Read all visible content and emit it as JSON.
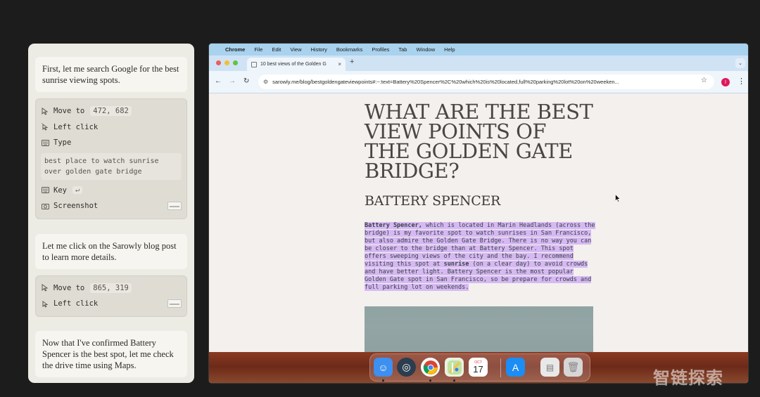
{
  "agent_panel": {
    "msg1": "First, let me search Google for the best sunrise viewing spots.",
    "actions1": [
      {
        "icon": "cursor-move-icon",
        "label": "Move to",
        "value": "472, 682"
      },
      {
        "icon": "cursor-click-icon",
        "label": "Left click",
        "value": ""
      },
      {
        "icon": "keyboard-icon",
        "label": "Type",
        "value": ""
      },
      {
        "icon": "keyboard-icon",
        "label": "Key",
        "value": "↵"
      },
      {
        "icon": "camera-icon",
        "label": "Screenshot",
        "value": ""
      }
    ],
    "typed_text": "best place to watch sunrise over golden gate bridge",
    "msg2": "Let me click on the Sarowly blog post to learn more details.",
    "actions2": [
      {
        "icon": "cursor-move-icon",
        "label": "Move to",
        "value": "865, 319"
      },
      {
        "icon": "cursor-click-icon",
        "label": "Left click",
        "value": ""
      }
    ],
    "msg3": "Now that I've confirmed Battery Spencer is the best spot, let me check the drive time using Maps."
  },
  "menubar": {
    "apple": "",
    "app": "Chrome",
    "items": [
      "File",
      "Edit",
      "View",
      "History",
      "Bookmarks",
      "Profiles",
      "Tab",
      "Window",
      "Help"
    ]
  },
  "browser": {
    "tab_title": "10 best views of the Golden G",
    "tab_close": "×",
    "new_tab": "+",
    "url": "sarowly.me/blog/bestgoldengateviewpoints#:~:text=Battery%20Spencer%2C%20which%20is%20located,full%20parking%20lot%20on%20weeken...",
    "profile_initial": "I"
  },
  "article": {
    "heading": "WHAT ARE THE BEST VIEW POINTS OF THE GOLDEN GATE BRIDGE?",
    "subheading": "BATTERY SPENCER",
    "para_bold": "Battery Spencer,",
    "para_1": " which is located in Marin Headlands (across the bridge) is my favorite spot to watch sunrises in San Francisco, but also admire the Golden Gate Bridge. There is no way you can be closer to the bridge than at Battery Spencer. This spot offers sweeping views of the city and the bay. I recommend visiting this spot at ",
    "para_bold2": "sunrise",
    "para_2": " (on a clear day) to avoid crowds and have better light. Battery Spencer is the most popular Golden Gate spot in San Francisco, so be prepare for crowds and full parking lot on weekends."
  },
  "dock": {
    "calendar_month": "OCT",
    "calendar_day": "17"
  },
  "watermark": "智链探索"
}
